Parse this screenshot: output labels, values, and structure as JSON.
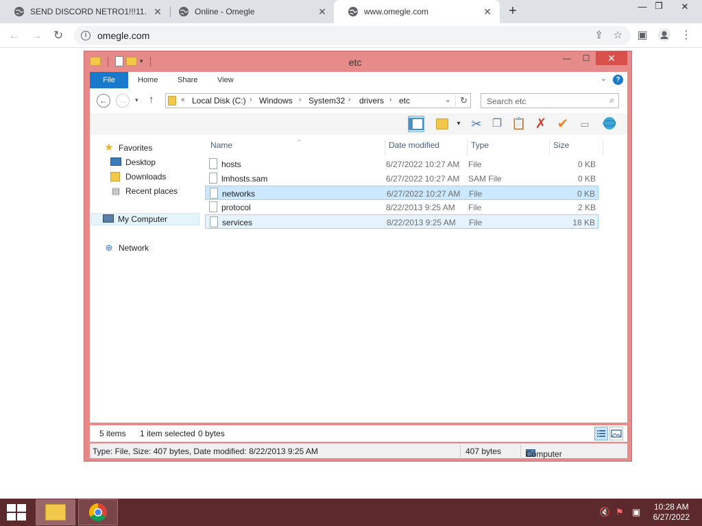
{
  "browser": {
    "tabs": [
      {
        "title": "SEND DISCORD NETRO1!!!11.png"
      },
      {
        "title": "Online - Omegle"
      },
      {
        "title": "www.omegle.com"
      }
    ],
    "url": "omegle.com"
  },
  "explorer": {
    "title": "etc",
    "ribbon_tabs": {
      "file": "File",
      "home": "Home",
      "share": "Share",
      "view": "View"
    },
    "breadcrumb": {
      "overflow": "«",
      "items": [
        "Local Disk (C:)",
        "Windows",
        "System32",
        "drivers",
        "etc"
      ]
    },
    "search_placeholder": "Search etc",
    "nav": {
      "favorites": "Favorites",
      "desktop": "Desktop",
      "downloads": "Downloads",
      "recent": "Recent places",
      "computer": "My Computer",
      "network": "Network"
    },
    "columns": {
      "name": "Name",
      "date": "Date modified",
      "type": "Type",
      "size": "Size"
    },
    "files": [
      {
        "name": "hosts",
        "date": "6/27/2022 10:27 AM",
        "type": "File",
        "size": "0 KB"
      },
      {
        "name": "lmhosts.sam",
        "date": "6/27/2022 10:27 AM",
        "type": "SAM File",
        "size": "0 KB"
      },
      {
        "name": "networks",
        "date": "6/27/2022 10:27 AM",
        "type": "File",
        "size": "0 KB"
      },
      {
        "name": "protocol",
        "date": "8/22/2013 9:25 AM",
        "type": "File",
        "size": "2 KB"
      },
      {
        "name": "services",
        "date": "8/22/2013 9:25 AM",
        "type": "File",
        "size": "18 KB"
      }
    ],
    "status": {
      "items": "5 items",
      "selected": "1 item selected",
      "bytes": "0 bytes",
      "details": "Type: File, Size: 407 bytes, Date modified: 8/22/2013 9:25 AM",
      "size": "407 bytes",
      "location": "Computer"
    }
  },
  "taskbar": {
    "time": "10:28 AM",
    "date": "6/27/2022"
  },
  "colors": {
    "window_frame": "#e78a8a",
    "taskbar": "#5c2a2d",
    "ribbon_file": "#1979ca",
    "selection": "#cce8ff"
  }
}
